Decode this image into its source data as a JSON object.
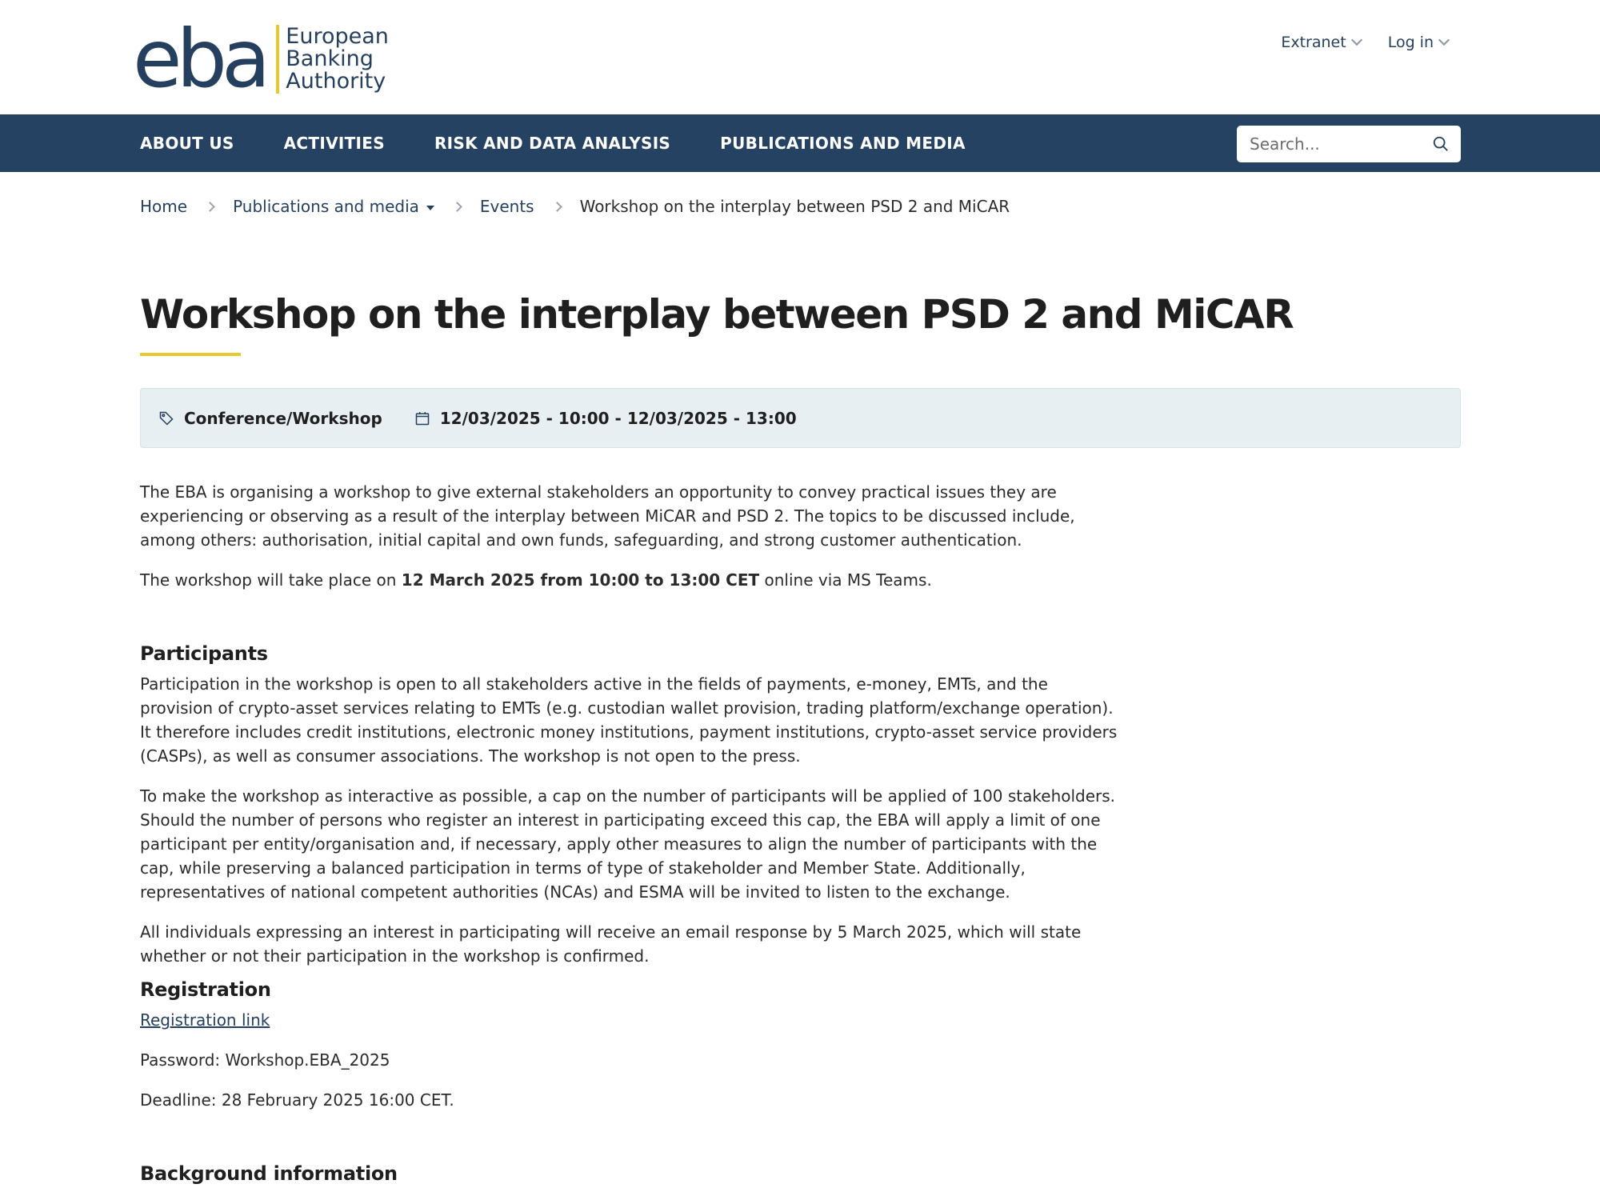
{
  "header": {
    "logo_mark": "eba",
    "logo_lines": [
      "European",
      "Banking",
      "Authority"
    ],
    "top_links": [
      {
        "label": "Extranet",
        "icon": "chevron-down-icon"
      },
      {
        "label": "Log in",
        "icon": "chevron-down-icon"
      }
    ]
  },
  "nav": {
    "items": [
      "ABOUT US",
      "ACTIVITIES",
      "RISK AND DATA ANALYSIS",
      "PUBLICATIONS AND MEDIA"
    ],
    "search_placeholder": "Search...",
    "search_icon": "search-icon"
  },
  "breadcrumb": {
    "items": [
      "Home",
      "Publications and media",
      "Events",
      "Workshop on the interplay between PSD 2 and MiCAR"
    ]
  },
  "page": {
    "title": "Workshop on the interplay between PSD 2 and MiCAR",
    "meta": {
      "type": "Conference/Workshop",
      "type_icon": "tag-icon",
      "date": "12/03/2025 - 10:00 - 12/03/2025 - 13:00",
      "date_icon": "calendar-icon"
    },
    "intro": "The EBA is organising  a workshop to give external stakeholders an opportunity to convey practical issues they are experiencing or observing as a result of the interplay between MiCAR and PSD 2. The topics to be discussed include, among others: authorisation, initial capital and own funds, safeguarding, and strong customer authentication.",
    "when_prefix": "The workshop will take place on ",
    "when_bold": "12 March 2025 from 10:00 to 13:00 CET",
    "when_suffix": " online via MS Teams.",
    "participants_heading": "Participants",
    "participants_p1": "Participation in the workshop is open to all stakeholders active in the fields of payments, e-money, EMTs, and the provision of crypto-asset services relating to EMTs (e.g. custodian wallet provision, trading platform/exchange operation). It therefore includes credit institutions, electronic money institutions, payment institutions, crypto-asset service providers (CASPs), as well as consumer associations. The workshop is not open to the press.",
    "participants_p2": "To make the workshop as interactive as possible, a cap on the number of participants will be applied of 100 stakeholders. Should the number of persons who register an interest in participating exceed this cap, the EBA will apply a limit of one participant per entity/organisation and, if necessary, apply other measures to align the number of participants with the cap, while preserving a balanced participation in terms of  type of stakeholder and Member State. Additionally, representatives of national competent authorities (NCAs) and ESMA will be invited to listen to the exchange.",
    "participants_p3": "All individuals expressing an interest in participating will receive an email response by 5 March 2025, which will state whether or not their participation in the workshop is confirmed.",
    "registration_heading": "Registration",
    "registration_link": "Registration link ",
    "password": "Password: Workshop.EBA_2025",
    "deadline": "Deadline: 28 February 2025 16:00 CET.",
    "background_heading": "Background information"
  }
}
